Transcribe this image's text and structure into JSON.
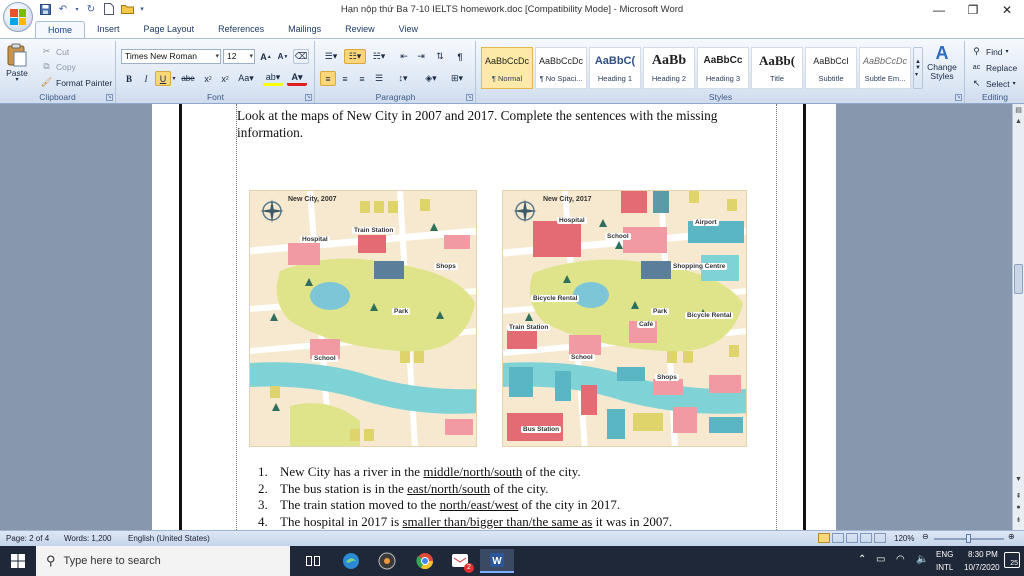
{
  "window": {
    "title": "Hạn nộp thứ Ba 7-10 IELTS homework.doc [Compatibility Mode] - Microsoft Word",
    "controls": {
      "minimize": "—",
      "maximize": "❐",
      "close": "✕"
    }
  },
  "quick_access": [
    "save-icon",
    "undo-icon",
    "redo-icon",
    "new-doc-icon",
    "open-folder-icon"
  ],
  "tabs": [
    "Home",
    "Insert",
    "Page Layout",
    "References",
    "Mailings",
    "Review",
    "View"
  ],
  "ribbon": {
    "clipboard": {
      "paste": "Paste",
      "cut": "Cut",
      "copy": "Copy",
      "format_painter": "Format Painter",
      "label": "Clipboard"
    },
    "font": {
      "family": "Times New Roman",
      "size": "12",
      "label": "Font"
    },
    "paragraph": {
      "label": "Paragraph"
    },
    "styles": {
      "items": [
        {
          "sample": "AaBbCcDc",
          "name": "¶ Normal"
        },
        {
          "sample": "AaBbCcDc",
          "name": "¶ No Spaci..."
        },
        {
          "sample": "AaBbC(",
          "name": "Heading 1"
        },
        {
          "sample": "AaBb",
          "name": "Heading 2"
        },
        {
          "sample": "AaBbCc",
          "name": "Heading 3"
        },
        {
          "sample": "AaBb(",
          "name": "Title"
        },
        {
          "sample": "AaBbCcI",
          "name": "Subtitle"
        },
        {
          "sample": "AaBbCcDc",
          "name": "Subtle Em..."
        }
      ],
      "change_styles": "Change Styles",
      "label": "Styles"
    },
    "editing": {
      "find": "Find",
      "replace": "Replace",
      "select": "Select",
      "label": "Editing"
    }
  },
  "document": {
    "intro": "Look at the maps of New City in 2007 and 2017. Complete the sentences with the missing information.",
    "maps": [
      {
        "title": "New City, 2007",
        "labels": [
          "Train Station",
          "Hospital",
          "Shops",
          "Park",
          "School"
        ]
      },
      {
        "title": "New City, 2017",
        "labels": [
          "Hospital",
          "School",
          "Airport",
          "Shopping Centre",
          "Bicycle Rental",
          "Park",
          "Café",
          "Bicycle Rental",
          "Train Station",
          "School",
          "Shops",
          "Bus Station"
        ]
      }
    ],
    "questions": [
      {
        "num": "1.",
        "pre": "New City has a river in the ",
        "options": "middle/north/south",
        "post": " of the city."
      },
      {
        "num": "2.",
        "pre": "The bus station  is in the ",
        "options": "east/north/south",
        "post": "  of the city."
      },
      {
        "num": "3.",
        "pre": "The train station moved to the ",
        "options": "north/east/west",
        "post": "  of the city in 2017."
      },
      {
        "num": "4.",
        "pre": "The hospital in 2017 is ",
        "options": "smaller than/bigger than/the same as",
        "post": " it was in 2007."
      }
    ]
  },
  "status": {
    "page": "Page: 2 of 4",
    "words": "Words: 1,200",
    "language": "English (United States)",
    "zoom": "120%"
  },
  "taskbar": {
    "search_placeholder": "Type here to search",
    "lang_top": "ENG",
    "lang_bottom": "INTL",
    "time": "8:30 PM",
    "date": "10/7/2020",
    "notifications": "25",
    "chrome_badge": "2"
  }
}
